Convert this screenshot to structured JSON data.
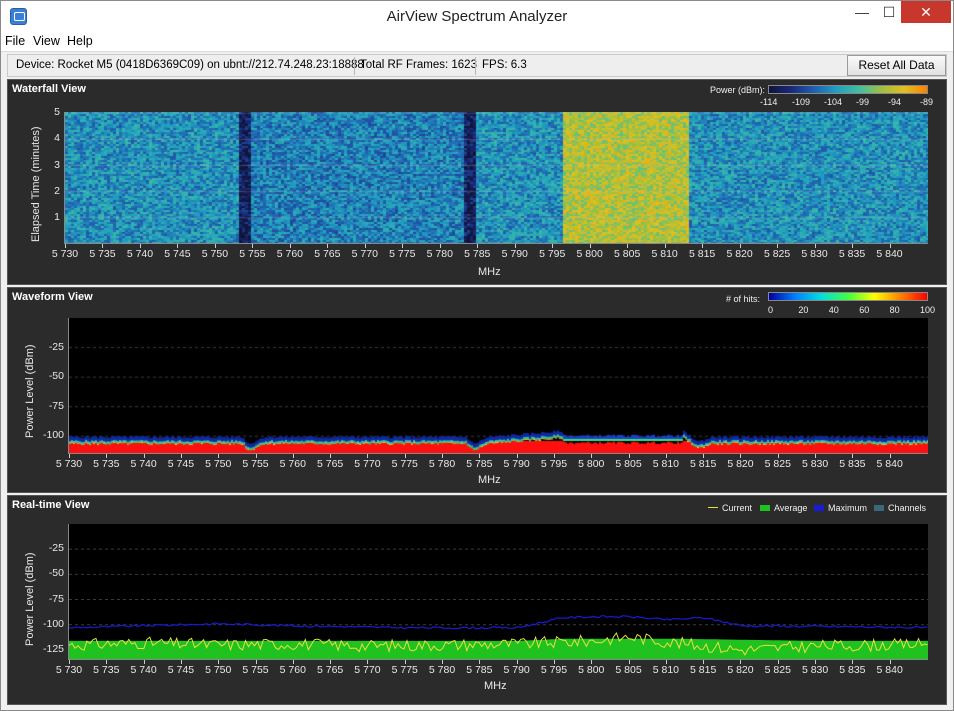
{
  "window": {
    "title": "AirView Spectrum Analyzer",
    "min_glyph": "—",
    "max_glyph": "☐",
    "close_glyph": "✕"
  },
  "menu": {
    "items": [
      "File",
      "View",
      "Help"
    ]
  },
  "toolbar": {
    "device": "Device: Rocket M5 (0418D6369C09) on ubnt://212.74.248.23:18888",
    "frames": "Total RF Frames: 1623",
    "fps": "FPS: 6.3",
    "reset_label": "Reset All Data"
  },
  "x_ticks": [
    "5 730",
    "5 735",
    "5 740",
    "5 745",
    "5 750",
    "5 755",
    "5 760",
    "5 765",
    "5 770",
    "5 775",
    "5 780",
    "5 785",
    "5 790",
    "5 795",
    "5 800",
    "5 805",
    "5 810",
    "5 815",
    "5 820",
    "5 825",
    "5 830",
    "5 835",
    "5 840"
  ],
  "waterfall": {
    "title": "Waterfall View",
    "xlabel": "MHz",
    "ylabel": "Elapsed Time (minutes)",
    "y_ticks": [
      "5",
      "4",
      "3",
      "2",
      "1"
    ],
    "legend_title": "Power (dBm):",
    "legend_ticks": [
      "-114",
      "-109",
      "-104",
      "-99",
      "-94",
      "-89"
    ]
  },
  "waveform": {
    "title": "Waveform View",
    "xlabel": "MHz",
    "ylabel": "Power Level (dBm)",
    "y_ticks": [
      "-25",
      "-50",
      "-75",
      "-100"
    ],
    "legend_title": "# of hits:",
    "legend_ticks": [
      "0",
      "20",
      "40",
      "60",
      "80",
      "100"
    ]
  },
  "realtime": {
    "title": "Real-time View",
    "xlabel": "MHz",
    "ylabel": "Power Level (dBm)",
    "y_ticks": [
      "-25",
      "-50",
      "-75",
      "-100",
      "-125"
    ],
    "legend": [
      {
        "label": "Current",
        "color": "#e8e040"
      },
      {
        "label": "Average",
        "color": "#1fc21f"
      },
      {
        "label": "Maximum",
        "color": "#1a1ad8"
      },
      {
        "label": "Channels",
        "color": "#3a6a7a"
      }
    ]
  },
  "chart_data": [
    {
      "type": "heatmap",
      "title": "Waterfall View",
      "xlabel": "MHz",
      "ylabel": "Elapsed Time (minutes)",
      "xlim": [
        5730,
        5845
      ],
      "ylim": [
        0,
        5
      ],
      "colorbar_range_dbm": [
        -114,
        -89
      ],
      "grid": true,
      "notes_dbm_by_band": [
        {
          "x": [
            5730,
            5753
          ],
          "level": -104
        },
        {
          "x": [
            5753,
            5754.5
          ],
          "level": -112
        },
        {
          "x": [
            5754.5,
            5783
          ],
          "level": -105
        },
        {
          "x": [
            5783,
            5784.5
          ],
          "level": -112
        },
        {
          "x": [
            5784.5,
            5796
          ],
          "level": -104
        },
        {
          "x": [
            5796,
            5813
          ],
          "level": -95
        },
        {
          "x": [
            5813,
            5845
          ],
          "level": -104
        }
      ]
    },
    {
      "type": "heatmap",
      "title": "Waveform View",
      "xlabel": "MHz",
      "ylabel": "Power Level (dBm)",
      "xlim": [
        5730,
        5845
      ],
      "ylim": [
        -115,
        0
      ],
      "colorbar_range_hits": [
        0,
        100
      ],
      "grid": true,
      "noise_floor_dbm": [
        {
          "x": 5730,
          "y": -104
        },
        {
          "x": 5753,
          "y": -104
        },
        {
          "x": 5754,
          "y": -110
        },
        {
          "x": 5756,
          "y": -104
        },
        {
          "x": 5783,
          "y": -104
        },
        {
          "x": 5784,
          "y": -110
        },
        {
          "x": 5786,
          "y": -104
        },
        {
          "x": 5796,
          "y": -99
        },
        {
          "x": 5812,
          "y": -99
        },
        {
          "x": 5814,
          "y": -108
        },
        {
          "x": 5816,
          "y": -104
        },
        {
          "x": 5845,
          "y": -104
        }
      ]
    },
    {
      "type": "line",
      "title": "Real-time View",
      "xlabel": "MHz",
      "ylabel": "Power Level (dBm)",
      "xlim": [
        5730,
        5845
      ],
      "ylim": [
        -135,
        0
      ],
      "grid": true,
      "legend_placement": "top-right",
      "series": [
        {
          "name": "Maximum",
          "x": [
            5730,
            5750,
            5760,
            5775,
            5790,
            5796,
            5800,
            5805,
            5810,
            5815,
            5820,
            5835,
            5845
          ],
          "values": [
            -103,
            -99,
            -101,
            -103,
            -103,
            -93,
            -92,
            -92,
            -95,
            -93,
            -101,
            -102,
            -103
          ]
        },
        {
          "name": "Average",
          "x": [
            5730,
            5760,
            5790,
            5796,
            5812,
            5830,
            5845
          ],
          "values": [
            -116,
            -116,
            -116,
            -114,
            -114,
            -116,
            -116
          ]
        },
        {
          "name": "Current",
          "x": [
            5730,
            5740,
            5750,
            5760,
            5770,
            5780,
            5790,
            5800,
            5805,
            5810,
            5815,
            5820,
            5830,
            5840,
            5845
          ],
          "values": [
            -120,
            -118,
            -120,
            -119,
            -121,
            -120,
            -119,
            -116,
            -112,
            -117,
            -121,
            -125,
            -121,
            -120,
            -119
          ]
        }
      ]
    }
  ]
}
